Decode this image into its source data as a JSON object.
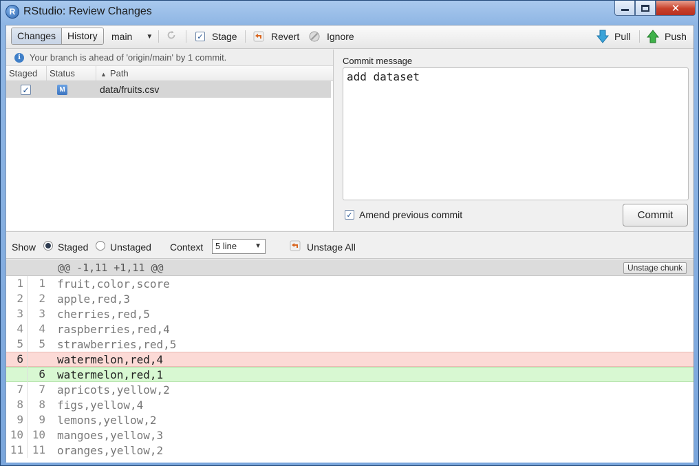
{
  "window": {
    "title": "RStudio: Review Changes",
    "app_icon_letter": "R"
  },
  "toolbar": {
    "tabs": [
      {
        "label": "Changes",
        "active": true
      },
      {
        "label": "History",
        "active": false
      }
    ],
    "branch": "main",
    "stage_label": "Stage",
    "revert_label": "Revert",
    "ignore_label": "Ignore",
    "pull_label": "Pull",
    "push_label": "Push"
  },
  "status": {
    "message": "Your branch is ahead of 'origin/main' by 1 commit."
  },
  "files_table": {
    "columns": [
      "Staged",
      "Status",
      "Path"
    ],
    "rows": [
      {
        "staged": true,
        "status": "M",
        "path": "data/fruits.csv"
      }
    ]
  },
  "commit": {
    "label": "Commit message",
    "message": "add dataset",
    "amend_label": "Amend previous commit",
    "amend_checked": true,
    "button_label": "Commit"
  },
  "show_bar": {
    "show_label": "Show",
    "staged_label": "Staged",
    "unstaged_label": "Unstaged",
    "selected": "Staged",
    "context_label": "Context",
    "context_value": "5 line",
    "unstage_all_label": "Unstage All"
  },
  "diff": {
    "chunk_header": "@@ -1,11 +1,11 @@",
    "unstage_chunk_label": "Unstage chunk",
    "lines": [
      {
        "old": "1",
        "new": "1",
        "text": "fruit,color,score",
        "type": "context"
      },
      {
        "old": "2",
        "new": "2",
        "text": "apple,red,3",
        "type": "context"
      },
      {
        "old": "3",
        "new": "3",
        "text": "cherries,red,5",
        "type": "context"
      },
      {
        "old": "4",
        "new": "4",
        "text": "raspberries,red,4",
        "type": "context"
      },
      {
        "old": "5",
        "new": "5",
        "text": "strawberries,red,5",
        "type": "context"
      },
      {
        "old": "6",
        "new": "",
        "text": "watermelon,red,4",
        "type": "del"
      },
      {
        "old": "",
        "new": "6",
        "text": "watermelon,red,1",
        "type": "add"
      },
      {
        "old": "7",
        "new": "7",
        "text": "apricots,yellow,2",
        "type": "context"
      },
      {
        "old": "8",
        "new": "8",
        "text": "figs,yellow,4",
        "type": "context"
      },
      {
        "old": "9",
        "new": "9",
        "text": "lemons,yellow,2",
        "type": "context"
      },
      {
        "old": "10",
        "new": "10",
        "text": "mangoes,yellow,3",
        "type": "context"
      },
      {
        "old": "11",
        "new": "11",
        "text": "oranges,yellow,2",
        "type": "context"
      }
    ]
  },
  "colors": {
    "deleted_bg": "#fcdad6",
    "added_bg": "#d8f8d2",
    "selected_row": "#d6d6d6"
  }
}
